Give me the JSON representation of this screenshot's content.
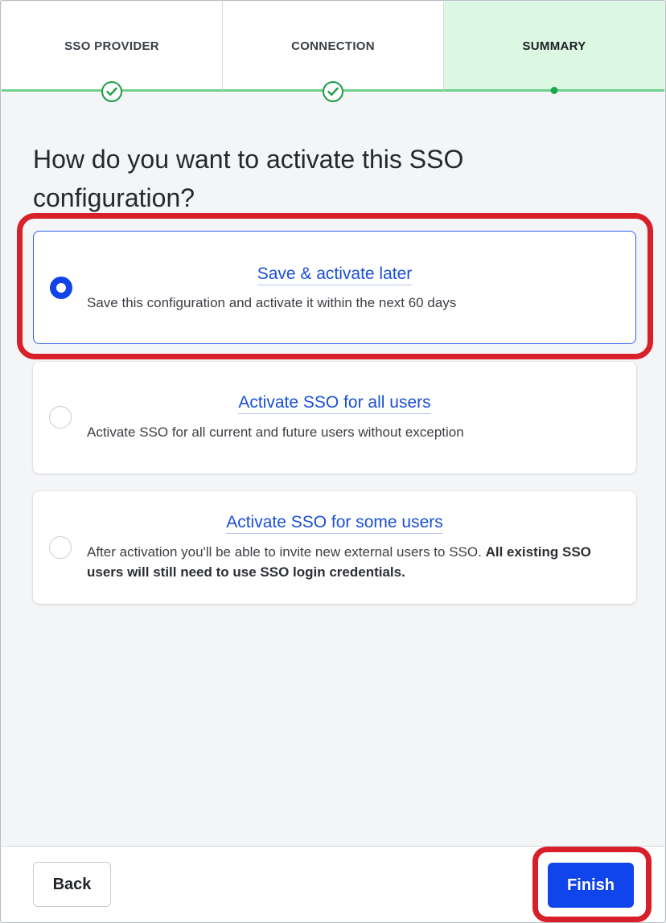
{
  "stepper": {
    "steps": [
      {
        "label": "SSO PROVIDER",
        "state": "complete"
      },
      {
        "label": "CONNECTION",
        "state": "complete"
      },
      {
        "label": "SUMMARY",
        "state": "current"
      }
    ]
  },
  "main": {
    "heading": "How do you want to activate this SSO configuration?",
    "options": [
      {
        "title": "Save & activate later",
        "description": "Save this configuration and activate it within the next 60 days",
        "selected": true
      },
      {
        "title": "Activate SSO for all users",
        "description": "Activate SSO for all current and future users without exception",
        "selected": false
      },
      {
        "title": "Activate SSO for some users",
        "description": "After activation you'll be able to invite new external users to SSO.",
        "description_bold": "All existing SSO users will still need to use SSO login credentials.",
        "selected": false
      }
    ]
  },
  "footer": {
    "back_label": "Back",
    "finish_label": "Finish"
  },
  "colors": {
    "accent": "#0f45eb",
    "link": "#1a4fd6",
    "success": "#1e9c45",
    "highlight": "#d8202a"
  }
}
